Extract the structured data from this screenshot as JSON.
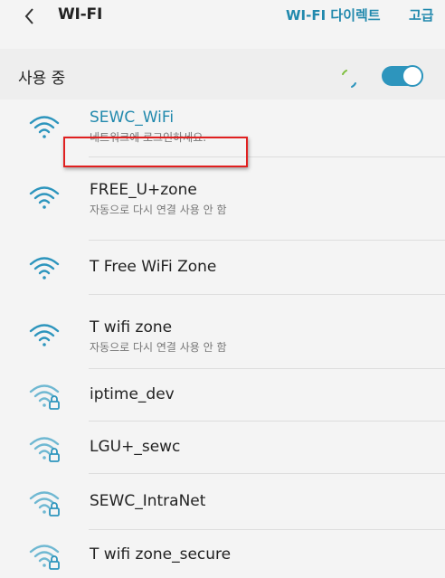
{
  "header": {
    "title": "WI-FI",
    "wifi_direct": "WI-FI 다이렉트",
    "advanced": "고급"
  },
  "in_use": {
    "label": "사용 중",
    "toggle_on": true
  },
  "colors": {
    "accent": "#2189ad",
    "highlight": "#e02020"
  },
  "networks": [
    {
      "name": "SEWC_WiFi",
      "status": "네트워크에 로그인하세요.",
      "secured": false,
      "active": true
    },
    {
      "name": "FREE_U+zone",
      "status": "자동으로 다시 연결 사용 안 함",
      "secured": false,
      "active": false
    },
    {
      "name": "T Free WiFi Zone",
      "status": "",
      "secured": false,
      "active": false
    },
    {
      "name": "T wifi zone",
      "status": "자동으로 다시 연결 사용 안 함",
      "secured": false,
      "active": false
    },
    {
      "name": "iptime_dev",
      "status": "",
      "secured": true,
      "active": false
    },
    {
      "name": "LGU+_sewc",
      "status": "",
      "secured": true,
      "active": false
    },
    {
      "name": "SEWC_IntraNet",
      "status": "",
      "secured": true,
      "active": false
    },
    {
      "name": "T wifi zone_secure",
      "status": "",
      "secured": true,
      "active": false
    }
  ]
}
